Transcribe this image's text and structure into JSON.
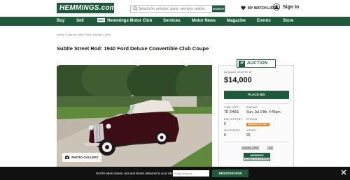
{
  "header": {
    "logo_text": "HEMMINGS.com",
    "search_placeholder": "Search for vehicles, parts, services, article...",
    "search_button": "SEARCH",
    "watchlist_label": "MY WATCH LIST",
    "signin_label": "Sign In"
  },
  "nav": {
    "items": [
      {
        "label": "Buy"
      },
      {
        "label": "Sell"
      },
      {
        "badge": "HMC",
        "label": "Hemmings Motor Club"
      },
      {
        "label": "Services"
      },
      {
        "label": "Motor News"
      },
      {
        "label": "Magazine"
      },
      {
        "label": "Events"
      },
      {
        "label": "Store"
      }
    ]
  },
  "breadcrumb": "Home / Cars for Sale / Ford / Deluxe / 1940",
  "listing": {
    "title": "Subtle Street Rod: 1940 Ford Deluxe Convertible Club Coupe",
    "gallery_button": "PHOTO GALLERY"
  },
  "auction": {
    "tag_letter": "H",
    "tag_label": "AUCTION",
    "bidding_starts_label": "BIDDING STARTS AT",
    "price": "$14,000",
    "place_bid": "PLACE BID",
    "time_left_label": "TIME LEFT",
    "time_left": "7D 2HRS",
    "ending_label": "ENDING",
    "ending": "Sun, Jul 14th, 4:45pm",
    "bid_history_label": "BID HISTORY",
    "bid_history": "0",
    "status_label": "STATUS",
    "status": "RESERVE NOT MET",
    "watchers_label": "WATCHERS",
    "watchers": "6",
    "views_label": "VIEWS",
    "views": "92",
    "contact_seller": "Contact Seller",
    "faq": "FAQ",
    "badge_top": "HEMMINGS",
    "badge_bottom": "CLASSIC CAR AUCTIONS"
  },
  "banner": {
    "text": "Get the latest classic cars and stories delivered to your inbox",
    "email_placeholder": "Email Address",
    "button": "REGISTER NOW"
  },
  "colors": {
    "brand_green": "#1f5a3d",
    "status_orange": "#d9892b",
    "banner_bg": "#111111"
  }
}
